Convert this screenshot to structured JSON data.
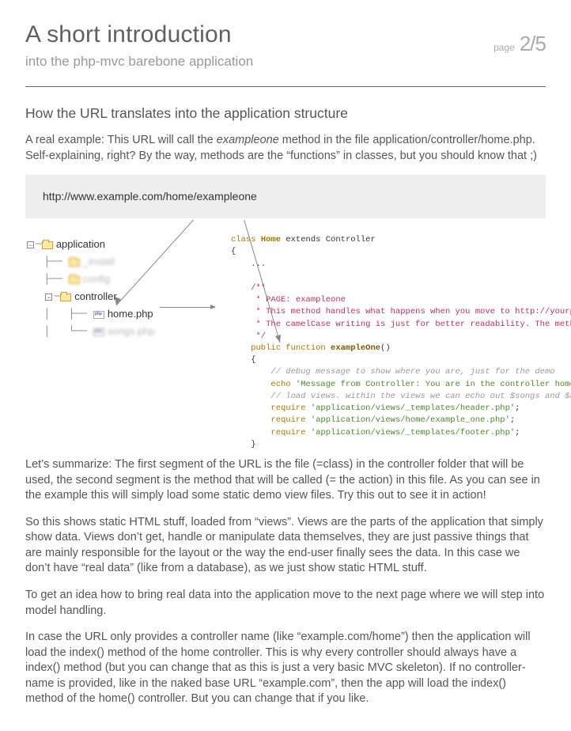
{
  "header": {
    "title": "A short introduction",
    "subtitle": "into the php-mvc barebone application",
    "page_label": "page",
    "page_num": "2/5"
  },
  "section": {
    "heading": "How the URL translates into the application structure",
    "intro_html": "A real example: This URL will call the <span class='em'>exampleone</span> method in the file application/controller/home.php. Self-explaining, right? By the way, methods are the “functions” in classes, but you should know that ;)",
    "url": "http://www.example.com/home/exampleone"
  },
  "tree": {
    "application": "application",
    "install": "_install",
    "config": "config",
    "controller": "controller",
    "home": "home.php",
    "songs": "songs.php"
  },
  "code": {
    "l1a": "class ",
    "l1b": "Home",
    "l1c": " extends Controller",
    "l2": "{",
    "l3": "    ...",
    "d1": "    /**",
    "d2": "     * PAGE: exampleone",
    "d3": "     * This method handles what happens when you move to http://yourproject/home/exampl",
    "d4": "     * The camelCase writing is just for better readability. The method name is case in",
    "d5": "     */",
    "l4a": "    public function ",
    "l4b": "exampleOne",
    "l4c": "()",
    "l5": "    {",
    "c1": "        // debug message to show where you are, just for the demo",
    "e1a": "        echo ",
    "e1b": "'Message from Controller: You are in the controller home, using the method",
    "c2": "        // load views. within the views we can echo out $songs and $amount_of_songs eas",
    "r1a": "        require ",
    "r1b": "'application/views/_templates/header.php'",
    "r1c": ";",
    "r2a": "        require ",
    "r2b": "'application/views/home/example_one.php'",
    "r2c": ";",
    "r3a": "        require ",
    "r3b": "'application/views/_templates/footer.php'",
    "r3c": ";",
    "l6": "    }"
  },
  "paragraphs": {
    "p1": "Let’s summarize: The first segment of the URL is the file (=class) in the controller folder that will be used, the second segment is the method that will be called (= the action) in this file. As you can see in the example this will simply load some static demo view files. Try this out to see it in action!",
    "p2": "So this shows static HTML stuff, loaded from “views”. Views are the parts of the application that simply show data. Views don’t get, handle or manipulate data themselves, they are just passive things that are mainly responsible for the layout or the way the end-user finally sees the data. In this case we don’t have “real data” (like from a database), as we just show static HTML stuff.",
    "p3": "To get an idea how to bring real data into the application move to the next page where we will step into model handling.",
    "p4": "In case the URL only provides a controller name (like “example.com/home”) then the application will load the index() method of the home controller. This is why every controller should always have a index() method (but you can change that as this is just a very basic MVC skeleton). If no controller-name is provided, like in the naked base URL “example.com”, then the app will load the index() method of the home() controller. But you can change that if you like."
  }
}
